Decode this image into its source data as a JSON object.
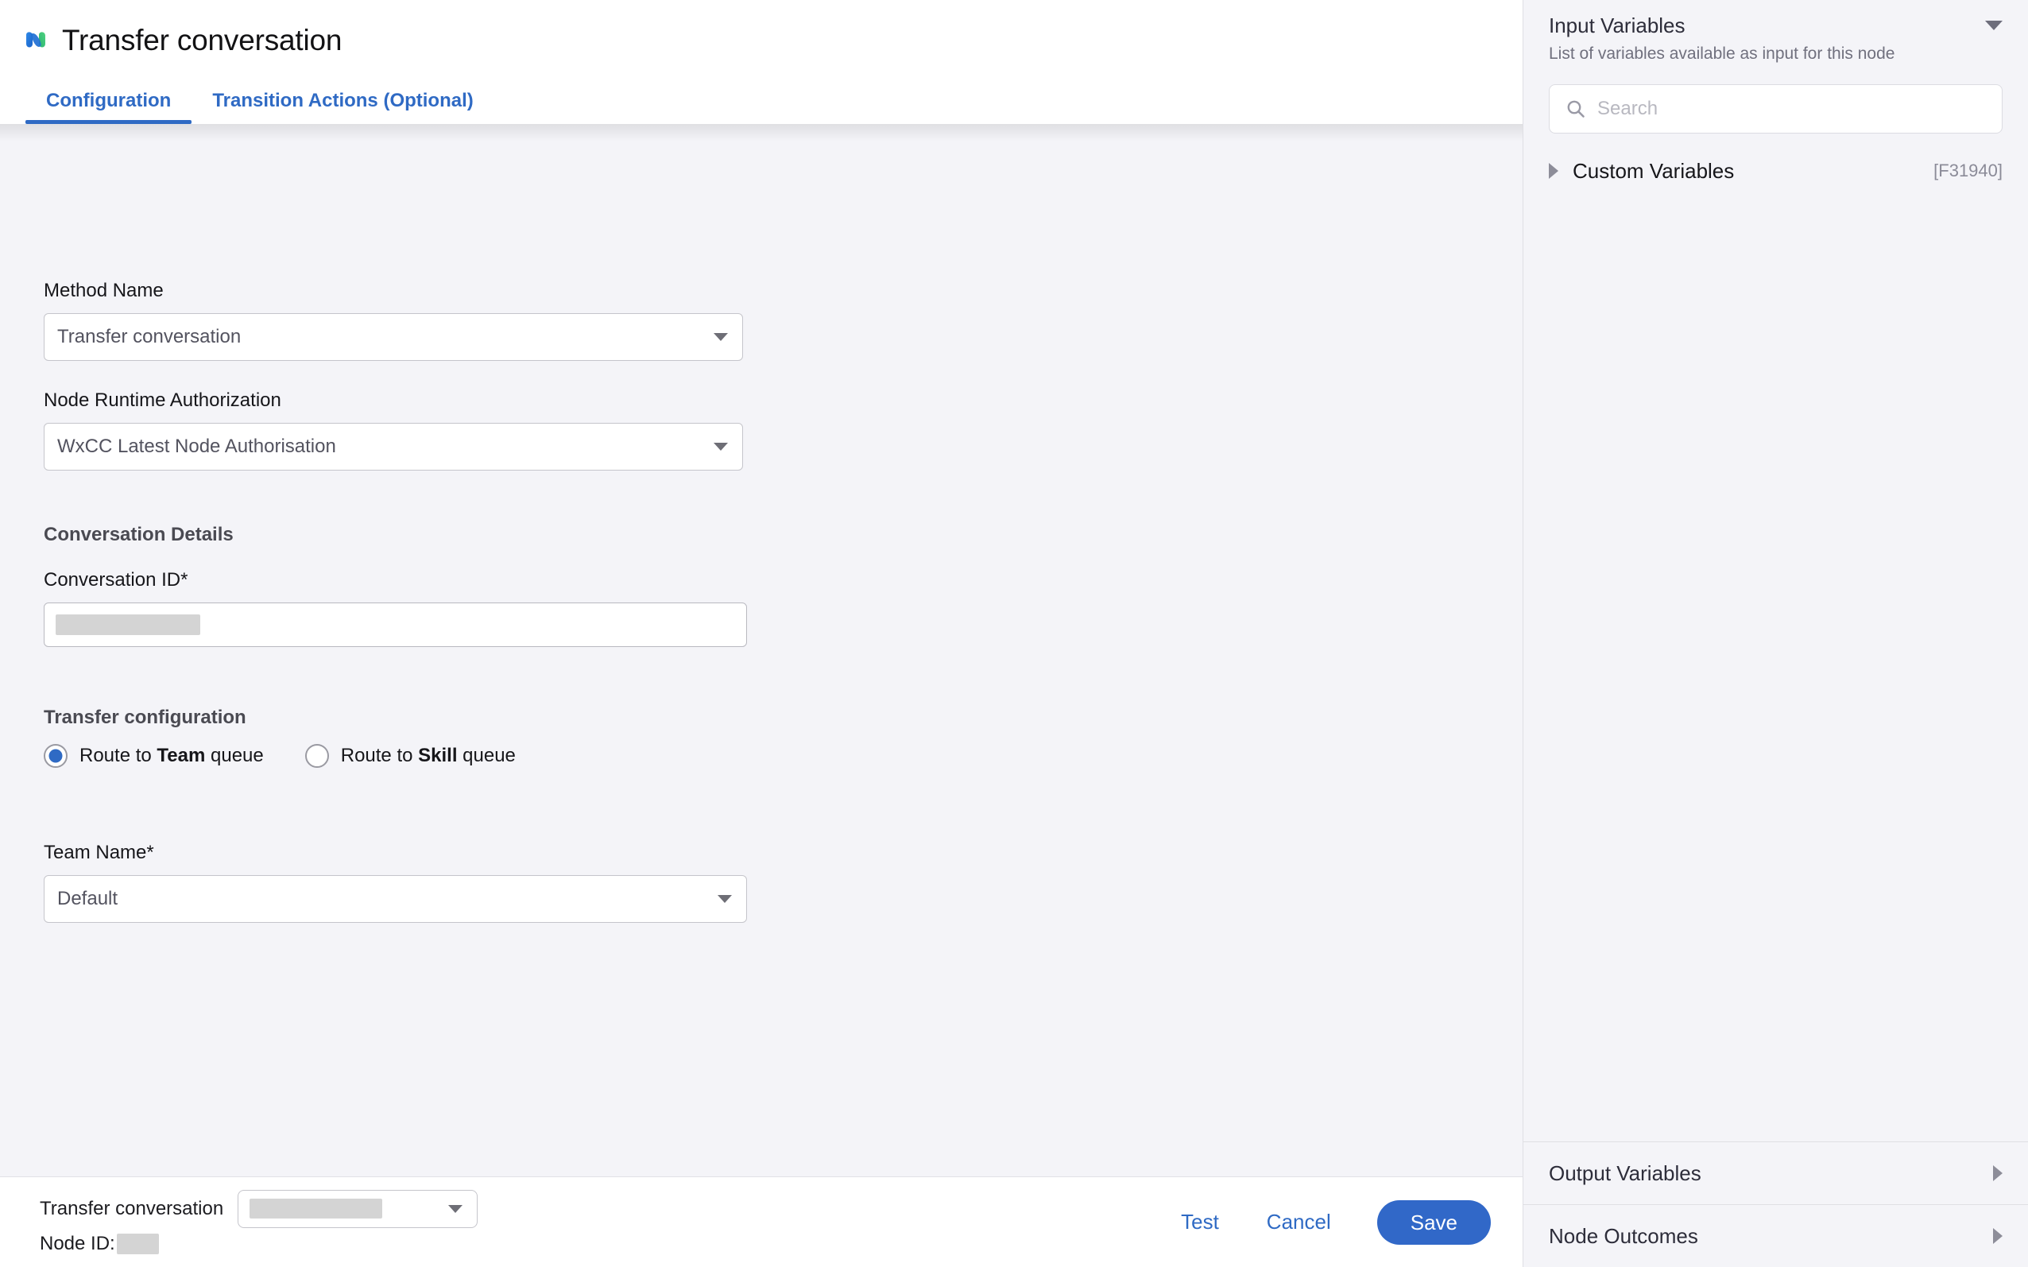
{
  "header": {
    "logo_icon": "webex-logo-icon",
    "title": "Transfer conversation",
    "tabs": [
      {
        "label": "Configuration",
        "active": true
      },
      {
        "label": "Transition Actions (Optional)",
        "active": false
      }
    ]
  },
  "form": {
    "method_name": {
      "label": "Method Name",
      "value": "Transfer conversation"
    },
    "node_runtime_authorization": {
      "label": "Node Runtime Authorization",
      "value": "WxCC Latest Node Authorisation"
    },
    "conversation_details": {
      "section_title": "Conversation Details",
      "conversation_id": {
        "label": "Conversation ID*",
        "value": "",
        "redacted": true
      }
    },
    "transfer_configuration": {
      "section_title": "Transfer configuration",
      "options": [
        {
          "prefix": "Route to ",
          "strong": "Team",
          "suffix": " queue",
          "selected": true
        },
        {
          "prefix": "Route to ",
          "strong": "Skill",
          "suffix": " queue",
          "selected": false
        }
      ]
    },
    "team_name": {
      "label": "Team Name*",
      "value": "Default"
    }
  },
  "footer": {
    "node_name": "Transfer conversation",
    "node_select_value": "",
    "node_id_label": "Node ID:",
    "node_id_value": "",
    "test_label": "Test",
    "cancel_label": "Cancel",
    "save_label": "Save"
  },
  "right_panel": {
    "input_variables": {
      "title": "Input Variables",
      "subtitle": "List of variables available as input for this node",
      "collapse_icon": "chevron-down-icon",
      "search": {
        "placeholder": "Search",
        "value": "",
        "icon": "search-icon"
      },
      "groups": [
        {
          "label": "Custom Variables",
          "badge": "[F31940]",
          "expand_icon": "chevron-right-icon"
        }
      ]
    },
    "sections": [
      {
        "label": "Output Variables",
        "expand_icon": "chevron-right-icon"
      },
      {
        "label": "Node Outcomes",
        "expand_icon": "chevron-right-icon"
      }
    ]
  },
  "colors": {
    "accent": "#2f6ac4",
    "primary_button": "#3168c8",
    "page_background": "#f4f4f8",
    "panel_background": "#ffffff"
  }
}
